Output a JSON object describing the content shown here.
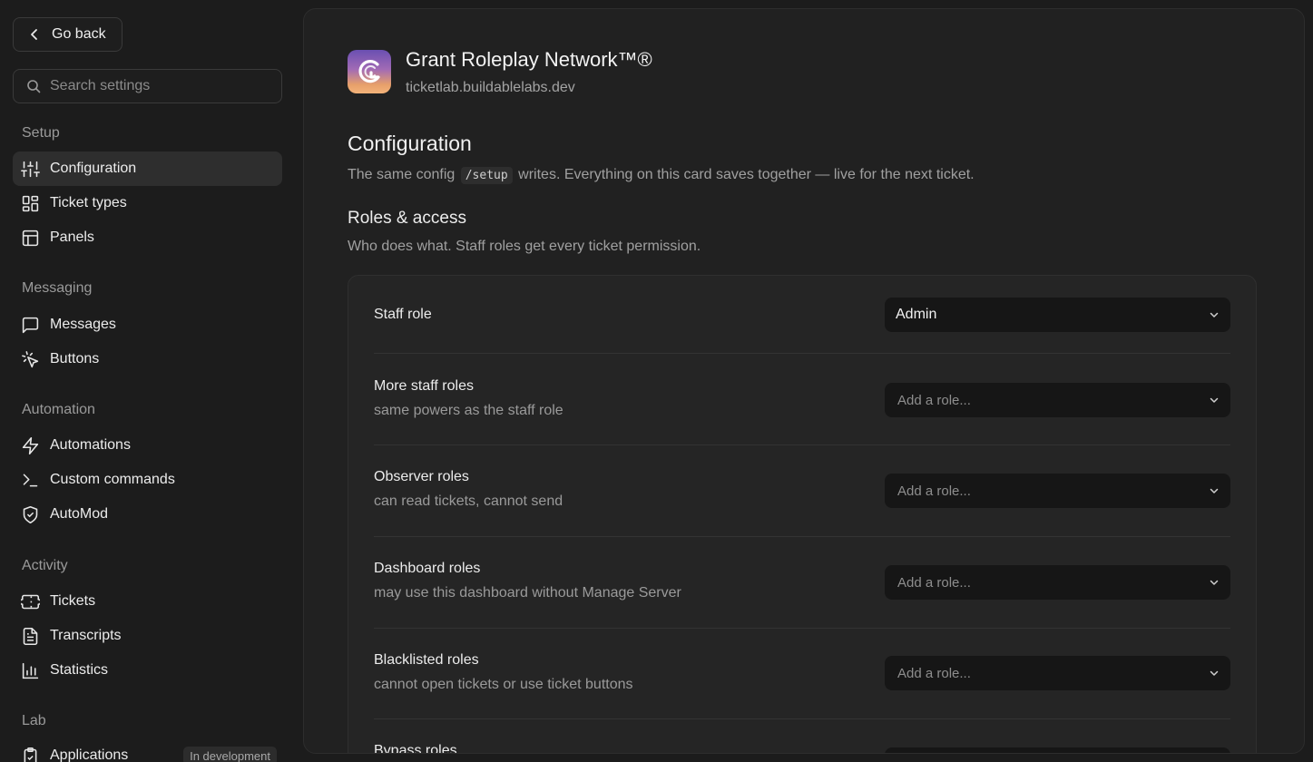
{
  "sidebar": {
    "back_label": "Go back",
    "search_placeholder": "Search settings",
    "sections": {
      "setup": "Setup",
      "messaging": "Messaging",
      "automation": "Automation",
      "activity": "Activity",
      "lab": "Lab"
    },
    "items": {
      "configuration": "Configuration",
      "ticket_types": "Ticket types",
      "panels": "Panels",
      "messages": "Messages",
      "buttons": "Buttons",
      "automations": "Automations",
      "custom_commands": "Custom commands",
      "automod": "AutoMod",
      "tickets": "Tickets",
      "transcripts": "Transcripts",
      "statistics": "Statistics",
      "applications": "Applications",
      "applications_badge": "In development"
    },
    "active_item": "configuration"
  },
  "server": {
    "name": "Grant Roleplay Network™®",
    "host": "ticketlab.buildablelabs.dev"
  },
  "main": {
    "heading": "Configuration",
    "desc_before": "The same config",
    "desc_code": "/setup",
    "desc_after": "writes. Everything on this card saves together — live for the next ticket.",
    "roles_heading": "Roles & access",
    "roles_sub": "Who does what. Staff roles get every ticket permission.",
    "rows": {
      "staff": {
        "title": "Staff role",
        "value": "Admin"
      },
      "more_staff": {
        "title": "More staff roles",
        "sub": "same powers as the staff role",
        "placeholder": "Add a role..."
      },
      "observer": {
        "title": "Observer roles",
        "sub": "can read tickets, cannot send",
        "placeholder": "Add a role..."
      },
      "dashboard": {
        "title": "Dashboard roles",
        "sub": "may use this dashboard without Manage Server",
        "placeholder": "Add a role..."
      },
      "blacklisted": {
        "title": "Blacklisted roles",
        "sub": "cannot open tickets or use ticket buttons",
        "placeholder": "Add a role..."
      },
      "bypass": {
        "title": "Bypass roles"
      }
    }
  },
  "colors": {
    "background": "#1c1c1c",
    "panel": "#212121",
    "card": "#252525",
    "select": "#161616",
    "active_nav": "#2e2e2e"
  }
}
